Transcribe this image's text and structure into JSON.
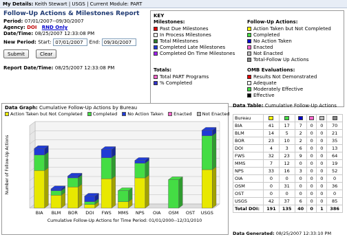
{
  "topbar": {
    "details_label": "My Details:",
    "details_value": "Keith Stewart | USGS | Current Module: PART"
  },
  "title": "Follow-Up Actions & Milestones Report",
  "period": {
    "label": "Period:",
    "value": "07/01/2007--09/30/2007"
  },
  "agency": {
    "label": "Agency:",
    "value": "DOI",
    "link": "RND Only"
  },
  "datetime": {
    "label": "Date/Time:",
    "value": "08/25/2007  12:33:08 PM"
  },
  "new_period": {
    "label": "New Period:",
    "start_label": "Start:",
    "start_value": "07/01/2007",
    "end_label": "End:",
    "end_value": "09/30/2007"
  },
  "buttons": {
    "submit": "Submit",
    "clear": "Clear"
  },
  "report_datetime": {
    "label": "Report Date/Time:",
    "value": "08/25/2007  12:33:08 PM"
  },
  "key": {
    "title": "KEY",
    "milestones_title": "Milestones:",
    "milestones": [
      {
        "label": "Past Due Milestones",
        "color": "#e00000"
      },
      {
        "label": "In Process Milestones",
        "color": "#ffffff"
      },
      {
        "label": "Total Milestones",
        "color": "#2e7d2e"
      },
      {
        "label": "Completed Late Milestones",
        "color": "#1f3bd6"
      },
      {
        "label": "Completed On Time Milestones",
        "color": "#a020f0"
      }
    ],
    "followup_title": "Follow-Up Actions:",
    "followup": [
      {
        "label": "Action Taken but Not Completed",
        "color": "#ffff00"
      },
      {
        "label": "Completed",
        "color": "#44dd44"
      },
      {
        "label": "No Action Taken",
        "color": "#0000cc"
      },
      {
        "label": "Enacted",
        "color": "#ff66cc"
      },
      {
        "label": "Not Enacted",
        "color": "#bbbbbb"
      },
      {
        "label": "Total-Follow Up Actions",
        "color": "#888888"
      }
    ],
    "totals_title": "Totals:",
    "totals": [
      {
        "label": "Total PART Programs",
        "color": "#ff66cc"
      },
      {
        "label": "% Completed",
        "color": "#3333cc"
      }
    ],
    "omb_title": "OMB Evaluations:",
    "omb": [
      {
        "label": "Results Not Demonstrated",
        "color": "#e00000"
      },
      {
        "label": "Adequate",
        "color": "#ffffff"
      },
      {
        "label": "Moderately Effective",
        "color": "#44dd44"
      },
      {
        "label": "Effective",
        "color": "#000000"
      }
    ]
  },
  "graph": {
    "label": "Data Graph:",
    "title": "Cumulative Follow-Up Actions by Bureau",
    "xlabel": "Cumulative Follow-Up Actions for Time Period: 01/01/2000--12/31/2010",
    "ylabel": "Number of Follow-Up Actions"
  },
  "chart_data": {
    "type": "bar",
    "stacked": true,
    "title": "Cumulative Follow-Up Actions by Bureau",
    "xlabel": "Cumulative Follow-Up Actions for Time Period: 01/01/2000--12/31/2010",
    "ylabel": "Number of Follow-Up Actions",
    "categories": [
      "BIA",
      "BLM",
      "BOR",
      "DOI",
      "FWS",
      "MMS",
      "NPS",
      "OIA",
      "OSM",
      "OST",
      "USGS"
    ],
    "series": [
      {
        "name": "Action Taken but Not Completed",
        "color": "#e8e800",
        "values": [
          41,
          14,
          23,
          4,
          32,
          7,
          33,
          0,
          0,
          0,
          42
        ]
      },
      {
        "name": "Completed",
        "color": "#44dd44",
        "values": [
          17,
          5,
          10,
          3,
          23,
          12,
          16,
          0,
          31,
          0,
          37
        ]
      },
      {
        "name": "No Action Taken",
        "color": "#1f3bd6",
        "values": [
          7,
          2,
          2,
          6,
          9,
          0,
          3,
          0,
          0,
          0,
          6
        ]
      },
      {
        "name": "Enacted",
        "color": "#ff66cc",
        "values": [
          0,
          0,
          0,
          0,
          0,
          0,
          0,
          0,
          0,
          0,
          0
        ]
      },
      {
        "name": "Not Enacted",
        "color": "#bbbbbb",
        "values": [
          0,
          0,
          0,
          0,
          0,
          0,
          0,
          0,
          0,
          0,
          0
        ]
      }
    ],
    "legend_position": "top",
    "grid": true,
    "ylim": [
      0,
      90
    ]
  },
  "table": {
    "label": "Data Table:",
    "title": "Cumulative Follow-Up Actions",
    "header_first": "Bureau",
    "header_colors": [
      "#ffff00",
      "#44dd44",
      "#0000cc",
      "#ff66cc",
      "#bbbbbb",
      "#888888"
    ],
    "rows": [
      {
        "bureau": "BIA",
        "vals": [
          "41",
          "17",
          "7",
          "0",
          "0",
          "70"
        ]
      },
      {
        "bureau": "BLM",
        "vals": [
          "14",
          "5",
          "2",
          "0",
          "0",
          "21"
        ]
      },
      {
        "bureau": "BOR",
        "vals": [
          "23",
          "10",
          "2",
          "0",
          "0",
          "35"
        ]
      },
      {
        "bureau": "DOI",
        "vals": [
          "4",
          "3",
          "6",
          "0",
          "0",
          "13"
        ]
      },
      {
        "bureau": "FWS",
        "vals": [
          "32",
          "23",
          "9",
          "0",
          "0",
          "64"
        ]
      },
      {
        "bureau": "MMS",
        "vals": [
          "7",
          "12",
          "0",
          "0",
          "0",
          "19"
        ]
      },
      {
        "bureau": "NPS",
        "vals": [
          "33",
          "16",
          "3",
          "0",
          "0",
          "52"
        ]
      },
      {
        "bureau": "OIA",
        "vals": [
          "0",
          "0",
          "0",
          "0",
          "0",
          "0"
        ]
      },
      {
        "bureau": "OSM",
        "vals": [
          "0",
          "31",
          "0",
          "0",
          "0",
          "36"
        ]
      },
      {
        "bureau": "OST",
        "vals": [
          "0",
          "0",
          "0",
          "0",
          "0",
          "0"
        ]
      },
      {
        "bureau": "USGS",
        "vals": [
          "42",
          "37",
          "6",
          "0",
          "0",
          "85"
        ]
      }
    ],
    "total": {
      "bureau": "Total DOI:",
      "vals": [
        "191",
        "135",
        "40",
        "0",
        "1",
        "386"
      ]
    },
    "generated_label": "Data Generated:",
    "generated_value": "08/25/2007  12:33:10 PM"
  }
}
